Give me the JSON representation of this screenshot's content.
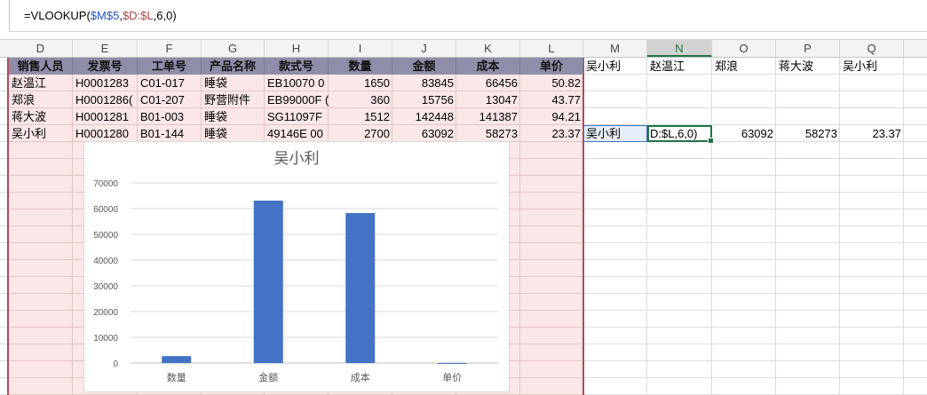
{
  "formula": {
    "prefix": "=VLOOKUP(",
    "ref1": "$M$5",
    "sep1": ",",
    "ref2": "$D:$L",
    "suffix": ",6,0)"
  },
  "columns": [
    "D",
    "E",
    "F",
    "G",
    "H",
    "I",
    "J",
    "K",
    "L",
    "M",
    "N",
    "O",
    "P",
    "Q"
  ],
  "selected_column": "N",
  "table": {
    "headers": [
      "销售人员",
      "发票号",
      "工单号",
      "产品名称",
      "款式号",
      "数量",
      "金额",
      "成本",
      "单价"
    ],
    "rows": [
      [
        "赵温江",
        "H0001283",
        "C01-017",
        "睡袋",
        "EB10070 0",
        "1650",
        "83845",
        "66456",
        "50.82"
      ],
      [
        "郑浪",
        "H0001286(",
        "C01-207",
        "野营附件",
        "EB99000F (",
        "360",
        "15756",
        "13047",
        "43.77"
      ],
      [
        "蒋大波",
        "H0001281",
        "B01-003",
        "睡袋",
        "SG11097F",
        "1512",
        "142448",
        "141387",
        "94.21"
      ],
      [
        "吴小利",
        "H0001280",
        "B01-144",
        "睡袋",
        "49146E 00",
        "2700",
        "63092",
        "58273",
        "23.37"
      ]
    ]
  },
  "lookup": {
    "names": [
      "吴小利",
      "赵温江",
      "郑浪",
      "蒋大波",
      "吴小利"
    ],
    "m5": "吴小利",
    "n5_editing": "D:$L,6,0)",
    "o5": "63092",
    "p5": "58273",
    "q5": "23.37"
  },
  "chart_data": {
    "type": "bar",
    "title": "吴小利",
    "categories": [
      "数量",
      "金额",
      "成本",
      "单价"
    ],
    "values": [
      2700,
      63092,
      58273,
      23.37
    ],
    "ylim": [
      0,
      70000
    ],
    "yticks": [
      0,
      10000,
      20000,
      30000,
      40000,
      50000,
      60000,
      70000
    ],
    "ytick_labels": [
      "0",
      "10000",
      "20000",
      "30000",
      "40000",
      "50000",
      "60000",
      "70000"
    ],
    "grid": true,
    "bar_color": "#4472c4"
  }
}
